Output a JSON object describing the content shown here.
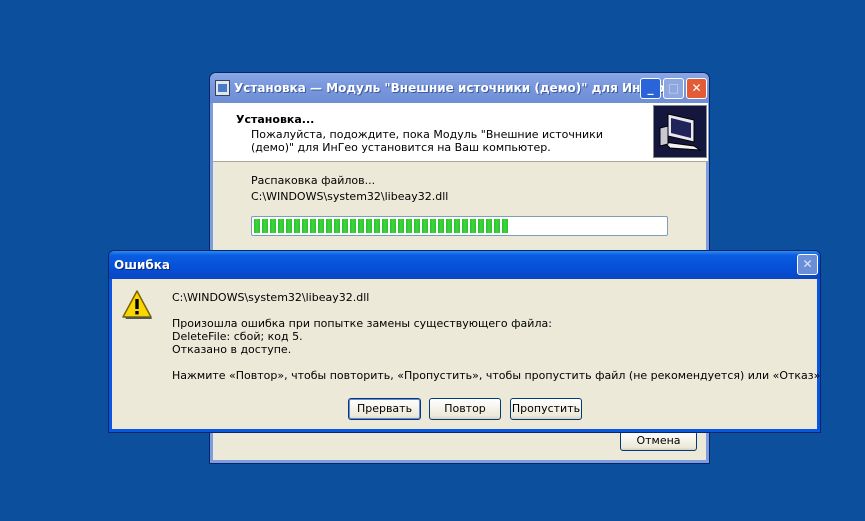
{
  "installer": {
    "title": "Установка — Модуль \"Внешние источники (демо)\" для ИнГео",
    "header_title": "Установка...",
    "header_desc": "Пожалуйста, подождите, пока Модуль \"Внешние источники (демо)\" для ИнГео установится на Ваш компьютер.",
    "status": "Распаковка файлов...",
    "file": "C:\\WINDOWS\\system32\\libeay32.dll",
    "progress": 0.62,
    "cancel_label": "Отмена"
  },
  "error_dialog": {
    "title": "Ошибка",
    "file": "C:\\WINDOWS\\system32\\libeay32.dll",
    "line1": "Произошла ошибка при попытке замены существующего файла:",
    "line2": "DeleteFile: сбой; код 5.",
    "line3": "Отказано в доступе.",
    "hint": "Нажмите «Повтор», чтобы повторить, «Пропустить», чтобы пропустить файл (не рекомендуется) или «Отказ» для выхода.",
    "buttons": {
      "abort": "Прервать",
      "retry": "Повтор",
      "skip": "Пропустить"
    }
  },
  "colors": {
    "desktop": "#0b4f9d",
    "progress_green": "#39d839",
    "xp_title_blue": "#0550d8"
  }
}
